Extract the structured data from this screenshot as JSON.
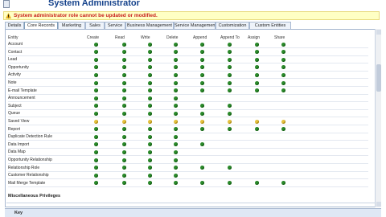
{
  "header": {
    "title": "System Administrator"
  },
  "warning": {
    "text": "System administrator role cannot be updated or modified."
  },
  "tabs": [
    "Details",
    "Core Records",
    "Marketing",
    "Sales",
    "Service",
    "Business Management",
    "Service Management",
    "Customization",
    "Custom Entities"
  ],
  "active_tab": "Core Records",
  "columns": [
    "Entity",
    "Create",
    "Read",
    "Write",
    "Delete",
    "Append",
    "Append To",
    "Assign",
    "Share"
  ],
  "rows": [
    {
      "entity": "Account",
      "privileges": [
        "org",
        "org",
        "org",
        "org",
        "org",
        "org",
        "org",
        "org"
      ]
    },
    {
      "entity": "Contact",
      "privileges": [
        "org",
        "org",
        "org",
        "org",
        "org",
        "org",
        "org",
        "org"
      ]
    },
    {
      "entity": "Lead",
      "privileges": [
        "org",
        "org",
        "org",
        "org",
        "org",
        "org",
        "org",
        "org"
      ]
    },
    {
      "entity": "Opportunity",
      "privileges": [
        "org",
        "org",
        "org",
        "org",
        "org",
        "org",
        "org",
        "org"
      ]
    },
    {
      "entity": "Activity",
      "privileges": [
        "org",
        "org",
        "org",
        "org",
        "org",
        "org",
        "org",
        "org"
      ]
    },
    {
      "entity": "Note",
      "privileges": [
        "org",
        "org",
        "org",
        "org",
        "org",
        "org",
        "org",
        "org"
      ]
    },
    {
      "entity": "E-mail Template",
      "privileges": [
        "org",
        "org",
        "org",
        "org",
        "org",
        "org",
        "org",
        "org"
      ]
    },
    {
      "entity": "Announcement",
      "privileges": [
        "org",
        "org",
        "org",
        "org",
        "",
        "",
        "",
        ""
      ]
    },
    {
      "entity": "Subject",
      "privileges": [
        "org",
        "org",
        "org",
        "org",
        "org",
        "org",
        "",
        ""
      ]
    },
    {
      "entity": "Queue",
      "privileges": [
        "org",
        "org",
        "org",
        "org",
        "org",
        "org",
        "",
        ""
      ]
    },
    {
      "entity": "Saved View",
      "privileges": [
        "user",
        "user",
        "user",
        "user",
        "user",
        "user",
        "user",
        "user"
      ]
    },
    {
      "entity": "Report",
      "privileges": [
        "org",
        "org",
        "org",
        "org",
        "org",
        "org",
        "org",
        "org"
      ]
    },
    {
      "entity": "Duplicate Detection Rule",
      "privileges": [
        "org",
        "org",
        "org",
        "org",
        "",
        "",
        "",
        ""
      ]
    },
    {
      "entity": "Data Import",
      "privileges": [
        "org",
        "org",
        "org",
        "org",
        "org",
        "",
        "",
        ""
      ]
    },
    {
      "entity": "Data Map",
      "privileges": [
        "org",
        "org",
        "org",
        "org",
        "",
        "",
        "",
        ""
      ]
    },
    {
      "entity": "Opportunity Relationship",
      "privileges": [
        "org",
        "org",
        "org",
        "org",
        "",
        "",
        "",
        ""
      ]
    },
    {
      "entity": "Relationship Role",
      "privileges": [
        "org",
        "org",
        "org",
        "org",
        "org",
        "org",
        "",
        ""
      ]
    },
    {
      "entity": "Customer Relationship",
      "privileges": [
        "org",
        "org",
        "org",
        "org",
        "",
        "",
        "",
        ""
      ]
    },
    {
      "entity": "Mail Merge Template",
      "privileges": [
        "org",
        "org",
        "org",
        "org",
        "org",
        "org",
        "org",
        "org"
      ]
    }
  ],
  "misc_section": {
    "title": "Miscellaneous Privileges"
  },
  "key_section": {
    "title": "Key"
  },
  "colors": {
    "organization": "#2b8a2b",
    "user": "#e5c23e",
    "accent": "#15428b",
    "warning": "#c81e1e"
  },
  "icons": {
    "role": "role-icon",
    "warning": "warning-icon"
  }
}
